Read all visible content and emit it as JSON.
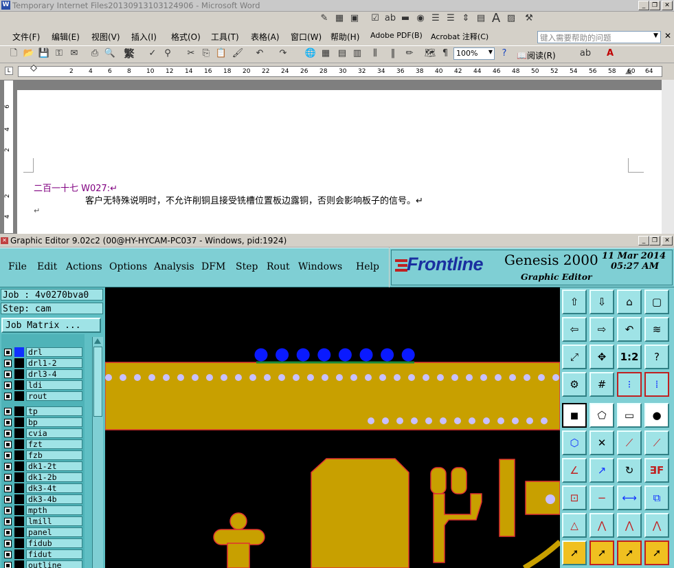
{
  "word": {
    "title": "Temporary Internet Files20130913103124906 - Microsoft Word",
    "menu": [
      "文件(F)",
      "编辑(E)",
      "视图(V)",
      "插入(I)",
      "格式(O)",
      "工具(T)",
      "表格(A)",
      "窗口(W)",
      "帮助(H)",
      "Adobe PDF(B)",
      "Acrobat 注释(C)"
    ],
    "help_placeholder": "键入需要帮助的问题",
    "zoom": "100%",
    "read_label": "阅读(R)",
    "ruler_ticks": [
      "2",
      "4",
      "6",
      "8",
      "10",
      "12",
      "14",
      "16",
      "18",
      "20",
      "22",
      "24",
      "26",
      "28",
      "30",
      "32",
      "34",
      "36",
      "38",
      "40",
      "42",
      "44",
      "46",
      "48",
      "50",
      "52",
      "54",
      "56",
      "58",
      "60",
      "64"
    ],
    "vruler_ticks": [
      "6",
      "4",
      "2",
      "2",
      "4"
    ],
    "doc_heading": "二百一十七 W027:↵",
    "doc_body": "客户无特殊说明时，不允许削铜且接受铣槽位置板边露铜，否则会影响板子的信号。↵",
    "return_mark": "↵"
  },
  "genesis": {
    "title": "Graphic Editor 9.02c2 (00@HY-HYCAM-PC037 - Windows, pid:1924)",
    "menu": [
      "File",
      "Edit",
      "Actions",
      "Options",
      "Analysis",
      "DFM",
      "Step",
      "Rout",
      "Windows",
      "Help"
    ],
    "brand": "Frontline",
    "product": "Genesis 2000",
    "subtitle": "Graphic Editor",
    "date": "11 Mar 2014",
    "time": "05:27 AM",
    "job": "Job : 4v0270bva0",
    "step": "Step: cam",
    "job_matrix": "Job Matrix ...",
    "layers_top": [
      {
        "name": "drl",
        "color": "#1030ff"
      },
      {
        "name": "drl1-2",
        "color": "#000000"
      },
      {
        "name": "drl3-4",
        "color": "#000000"
      },
      {
        "name": "ldi",
        "color": "#000000"
      },
      {
        "name": "rout",
        "color": "#000000"
      }
    ],
    "layers_bottom": [
      "tp",
      "bp",
      "cvia",
      "fzt",
      "fzb",
      "dk1-2t",
      "dk1-2b",
      "dk3-4t",
      "dk3-4b",
      "mpth",
      "lmill",
      "panel",
      "fidub",
      "fidut",
      "outline"
    ],
    "colors": {
      "copper": "#c8a000",
      "outline": "#e03030",
      "drill": "#0a1aff",
      "via": "#c8c0ff",
      "panel": "#7fcfd4"
    }
  }
}
